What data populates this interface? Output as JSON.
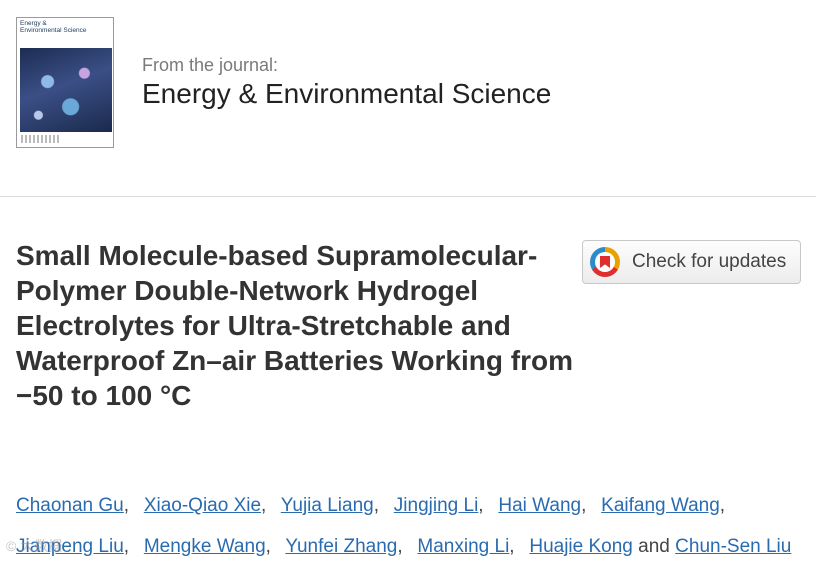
{
  "journal": {
    "cover_title": "Energy & Environmental Science",
    "label": "From the journal:",
    "name": "Energy & Environmental Science"
  },
  "article": {
    "title": "Small Molecule-based Supramolecular-Polymer Double-Network Hydrogel Electrolytes for Ultra-Stretchable and Waterproof Zn–air Batteries Working from −50 to 100 °C"
  },
  "check_updates": {
    "label": "Check for updates",
    "icon": "check-for-updates-icon"
  },
  "authors": [
    "Chaonan Gu",
    "Xiao-Qiao Xie",
    "Yujia Liang",
    "Jingjing Li",
    "Hai Wang",
    "Kaifang Wang",
    "Jianpeng Liu",
    "Mengke Wang",
    "Yunfei Zhang",
    "Manxing Li",
    "Huajie Kong",
    "Chun-Sen Liu"
  ],
  "authors_separator": ",",
  "authors_conjunction": "and",
  "watermark": "© 大数据"
}
